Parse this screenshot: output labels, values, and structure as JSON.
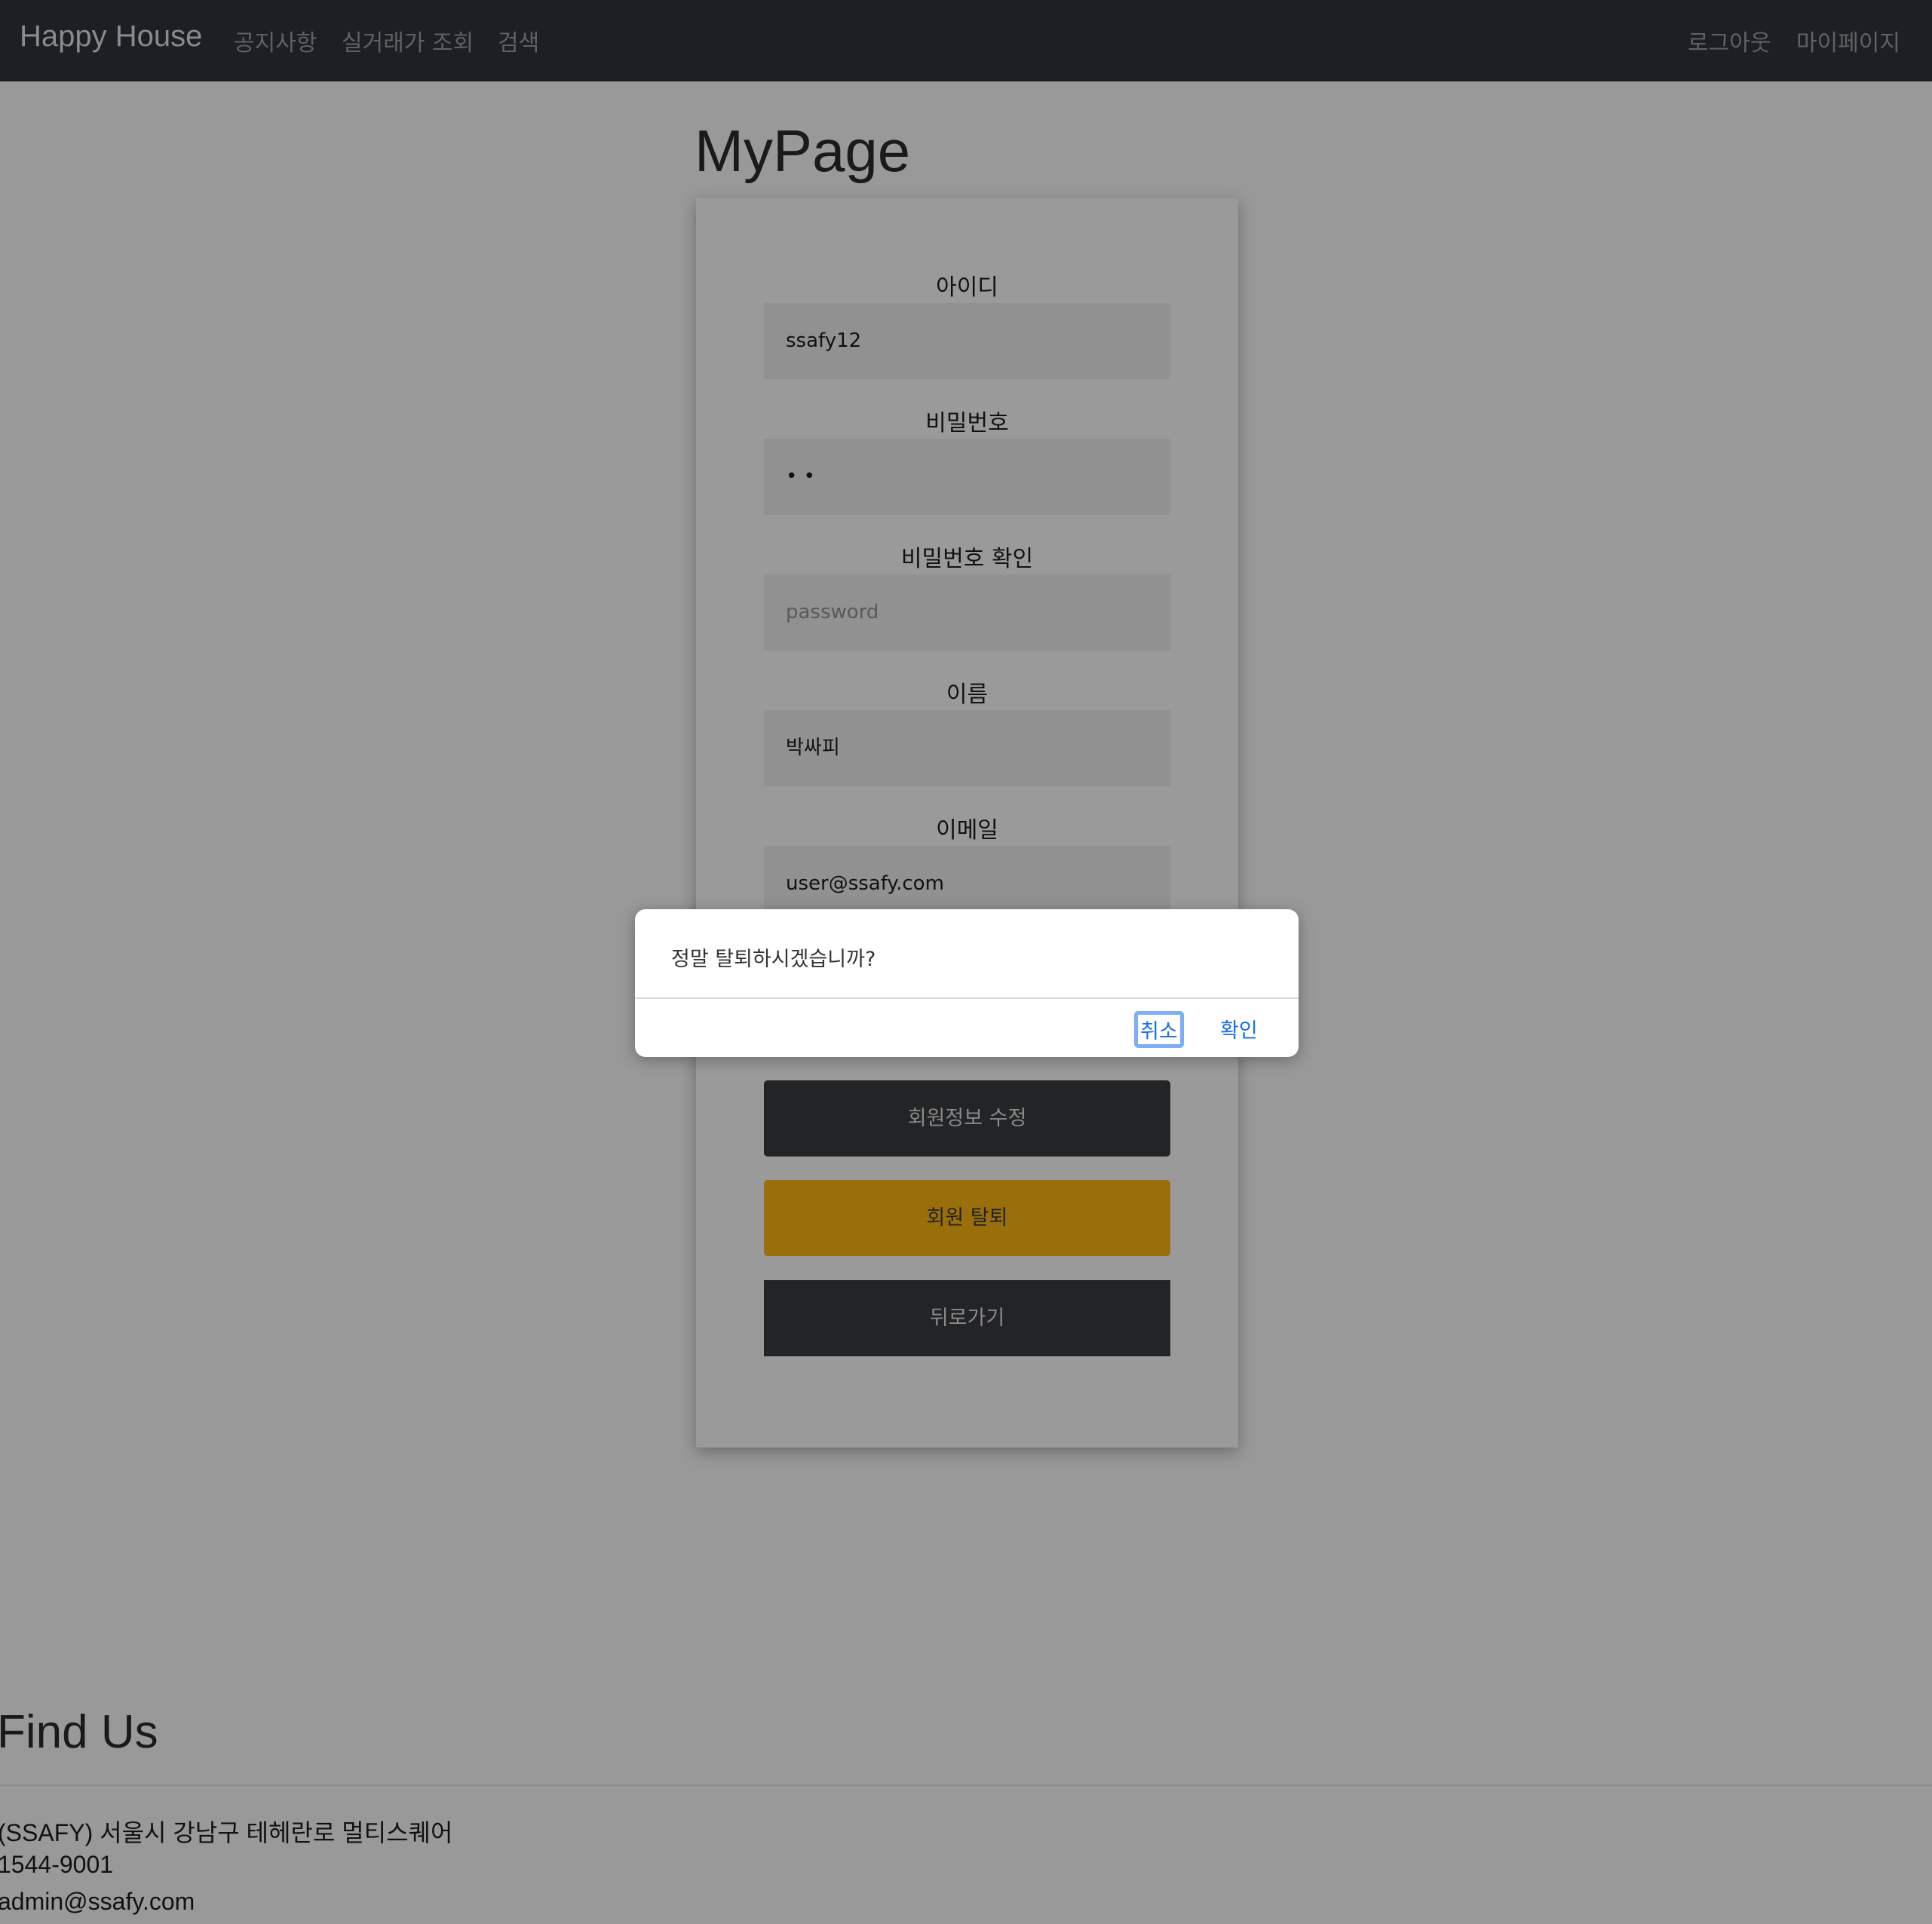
{
  "navbar": {
    "brand": "Happy House",
    "links": [
      "공지사항",
      "실거래가 조회",
      "검색"
    ],
    "right_links": [
      "로그아웃",
      "마이페이지"
    ]
  },
  "page_title": "MyPage",
  "form": {
    "id_label": "아이디",
    "id_value": "ssafy12",
    "pw_label": "비밀번호",
    "pw_value": "• •",
    "pw_confirm_label": "비밀번호 확인",
    "pw_confirm_placeholder": "password",
    "name_label": "이름",
    "name_value": "박싸피",
    "email_label": "이메일",
    "email_value": "user@ssafy.com"
  },
  "buttons": {
    "update": "회원정보 수정",
    "withdraw": "회원 탈퇴",
    "back": "뒤로가기"
  },
  "dialog": {
    "message": "정말 탈퇴하시겠습니까?",
    "cancel": "취소",
    "confirm": "확인"
  },
  "footer": {
    "title": "Find Us",
    "address": "(SSAFY) 서울시 강남구 테헤란로 멀티스퀘어",
    "phone": "1544-9001",
    "email": "admin@ssafy.com"
  },
  "colors": {
    "navbar": "#1c1f23",
    "withdraw": "#9a6f0b",
    "dialog_button": "#1a6fe6"
  }
}
